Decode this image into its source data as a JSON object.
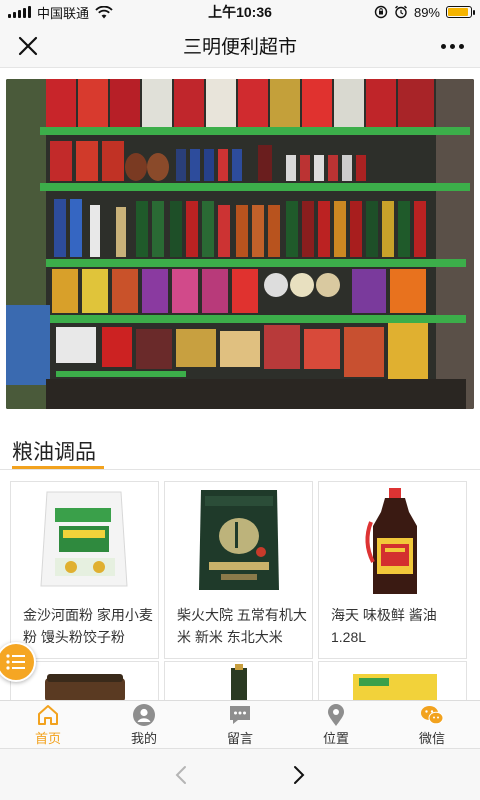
{
  "status_bar": {
    "carrier": "中国联通",
    "time": "上午10:36",
    "battery": "89%",
    "battery_level": 0.89
  },
  "nav": {
    "title": "三明便利超市",
    "close_icon": "close-icon",
    "more_icon": "more-icon"
  },
  "banner": {
    "description_icon": "store-shelf-photo"
  },
  "section": {
    "title": "粮油调品"
  },
  "products": [
    {
      "name": "金沙河面粉 家用小麦粉 馒头粉饺子粉"
    },
    {
      "name": "柴火大院 五常有机大米 新米 东北大米"
    },
    {
      "name": "海天 味极鲜 酱油 1.28L"
    }
  ],
  "tabs": [
    {
      "label": "首页",
      "icon": "home-icon",
      "active": true
    },
    {
      "label": "我的",
      "icon": "user-icon",
      "active": false
    },
    {
      "label": "留言",
      "icon": "message-icon",
      "active": false
    },
    {
      "label": "位置",
      "icon": "location-icon",
      "active": false
    },
    {
      "label": "微信",
      "icon": "wechat-icon",
      "active": false
    }
  ],
  "colors": {
    "accent": "#f2a21e",
    "battery": "#f5b400"
  }
}
